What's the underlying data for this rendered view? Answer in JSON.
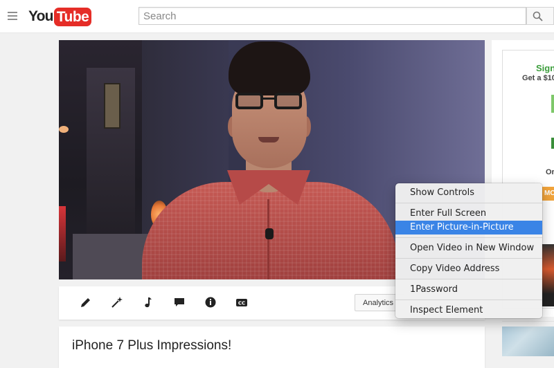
{
  "masthead": {
    "logo_you": "You",
    "logo_tube": "Tube",
    "search_placeholder": "Search"
  },
  "player": {
    "context_menu": {
      "groups": [
        [
          "Show Controls"
        ],
        [
          "Enter Full Screen",
          "Enter Picture-in-Picture"
        ],
        [
          "Open Video in New Window"
        ],
        [
          "Copy Video Address"
        ],
        [
          "1Password"
        ],
        [
          "Inspect Element"
        ]
      ],
      "highlighted": "Enter Picture-in-Picture"
    }
  },
  "actions": {
    "icons": [
      "pencil-icon",
      "magic-wand-icon",
      "music-note-icon",
      "comment-icon",
      "info-icon",
      "cc-icon"
    ],
    "analytics_label": "Analytics"
  },
  "video": {
    "title": "iPhone 7 Plus Impressions!"
  },
  "sidebar_ad": {
    "title": "Sign",
    "subtitle": "Get a $10",
    "or_text": "Or",
    "cta": "MC"
  },
  "colors": {
    "brand_red": "#e52d27",
    "menu_highlight": "#3a84e6",
    "ad_green": "#3a9d3a",
    "ad_orange": "#f2a43b"
  }
}
